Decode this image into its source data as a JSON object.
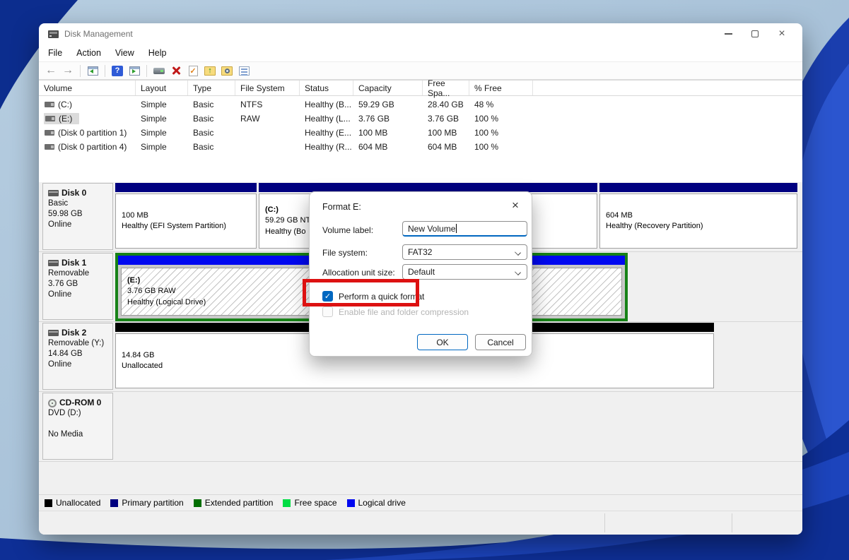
{
  "window": {
    "title": "Disk Management"
  },
  "menu": {
    "items": [
      "File",
      "Action",
      "View",
      "Help"
    ]
  },
  "icons": {
    "back": "←",
    "forward": "→",
    "help": "?",
    "doc_check": "✓",
    "up_arrow": "↑",
    "close": "×",
    "checkmark": "✓"
  },
  "volume_table": {
    "columns": [
      "Volume",
      "Layout",
      "Type",
      "File System",
      "Status",
      "Capacity",
      "Free Spa...",
      "% Free"
    ],
    "rows": [
      {
        "volume": "(C:)",
        "layout": "Simple",
        "type": "Basic",
        "fs": "NTFS",
        "status": "Healthy (B...",
        "capacity": "59.29 GB",
        "free": "28.40 GB",
        "pct": "48 %"
      },
      {
        "volume": "(E:)",
        "layout": "Simple",
        "type": "Basic",
        "fs": "RAW",
        "status": "Healthy (L...",
        "capacity": "3.76 GB",
        "free": "3.76 GB",
        "pct": "100 %"
      },
      {
        "volume": "(Disk 0 partition 1)",
        "layout": "Simple",
        "type": "Basic",
        "fs": "",
        "status": "Healthy (E...",
        "capacity": "100 MB",
        "free": "100 MB",
        "pct": "100 %"
      },
      {
        "volume": "(Disk 0 partition 4)",
        "layout": "Simple",
        "type": "Basic",
        "fs": "",
        "status": "Healthy (R...",
        "capacity": "604 MB",
        "free": "604 MB",
        "pct": "100 %"
      }
    ]
  },
  "disks": {
    "disk0": {
      "name": "Disk 0",
      "l1": "Basic",
      "l2": "59.98 GB",
      "l3": "Online",
      "p1": {
        "t1": "100 MB",
        "t2": "Healthy (EFI System Partition)"
      },
      "p2": {
        "t0": "(C:)",
        "t1": "59.29 GB NT",
        "t2": "Healthy (Bo"
      },
      "p3": {
        "t1": "604 MB",
        "t2": "Healthy (Recovery Partition)"
      }
    },
    "disk1": {
      "name": "Disk 1",
      "l1": "Removable",
      "l2": "3.76 GB",
      "l3": "Online",
      "p1": {
        "t0": "(E:)",
        "t1": "3.76 GB RAW",
        "t2": "Healthy (Logical Drive)"
      }
    },
    "disk2": {
      "name": "Disk 2",
      "l1": "Removable (Y:)",
      "l2": "14.84 GB",
      "l3": "Online",
      "p1": {
        "t1": "14.84 GB",
        "t2": "Unallocated"
      }
    },
    "cdrom": {
      "name": "CD-ROM 0",
      "l1": "DVD (D:)",
      "l3": "No Media"
    }
  },
  "legend": {
    "items": [
      {
        "label": "Unallocated",
        "color": "#000000"
      },
      {
        "label": "Primary partition",
        "color": "#000080"
      },
      {
        "label": "Extended partition",
        "color": "#006e00"
      },
      {
        "label": "Free space",
        "color": "#00dd44"
      },
      {
        "label": "Logical drive",
        "color": "#0008f0"
      }
    ]
  },
  "dialog": {
    "title": "Format E:",
    "volume_label": {
      "label": "Volume label:",
      "value": "New Volume"
    },
    "file_system": {
      "label": "File system:",
      "value": "FAT32"
    },
    "allocation_unit": {
      "label": "Allocation unit size:",
      "value": "Default"
    },
    "quick_format": {
      "label": "Perform a quick format",
      "checked": true
    },
    "compression": {
      "label": "Enable file and folder compression",
      "checked": false
    },
    "ok_label": "OK",
    "cancel_label": "Cancel"
  },
  "colors": {
    "accent": "#0067c0",
    "primary_partition": "#000080",
    "logical_drive": "#0008f0",
    "extended_partition": "#178217",
    "unallocated": "#000000",
    "annotation": "#dd1111"
  }
}
